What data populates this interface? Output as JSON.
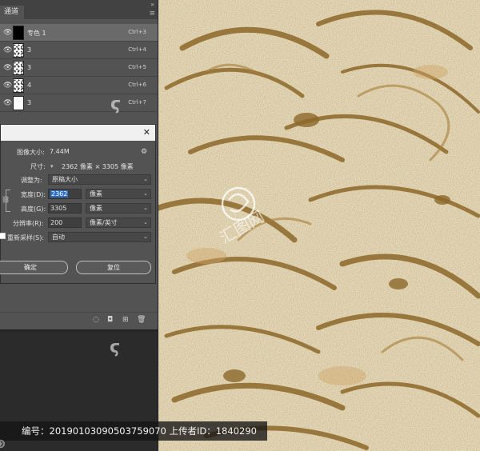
{
  "channels_panel": {
    "tab_label": "通道",
    "collapse_glyph": "»",
    "menu_glyph": "≡",
    "rows": [
      {
        "name": "专色 1",
        "shortcut": "Ctrl+3",
        "thumb": "black",
        "selected": true
      },
      {
        "name": "3",
        "shortcut": "Ctrl+4",
        "thumb": "speck",
        "selected": false
      },
      {
        "name": "3",
        "shortcut": "Ctrl+5",
        "thumb": "speck",
        "selected": false
      },
      {
        "name": "4",
        "shortcut": "Ctrl+6",
        "thumb": "speck",
        "selected": false
      },
      {
        "name": "3",
        "shortcut": "Ctrl+7",
        "thumb": "white",
        "selected": false
      }
    ]
  },
  "image_size_dialog": {
    "close_glyph": "✕",
    "image_size_label": "图像大小:",
    "image_size_value": "7.44M",
    "dimensions_label": "尺寸:",
    "dimensions_value": "2362 像素 × 3305 像素",
    "fit_to_label": "调整为:",
    "fit_to_value": "原稿大小",
    "width_label": "宽度(D):",
    "width_value": "2362",
    "width_unit": "像素",
    "height_label": "高度(G):",
    "height_value": "3305",
    "height_unit": "像素",
    "resolution_label": "分辨率(R):",
    "resolution_value": "200",
    "resolution_unit": "像素/英寸",
    "resample_label": "重新采样(S):",
    "resample_value": "自动",
    "ok_label": "确定",
    "reset_label": "复位"
  },
  "footer": {
    "text": "编号：20190103090503759070 上传者ID：1840290"
  },
  "colors": {
    "panel_bg": "#535353",
    "dark_bg": "#2b2b2b",
    "selection_blue": "#2f6ec6",
    "canvas_cream": "#e8dcc0",
    "canvas_brown": "#8a6324"
  }
}
